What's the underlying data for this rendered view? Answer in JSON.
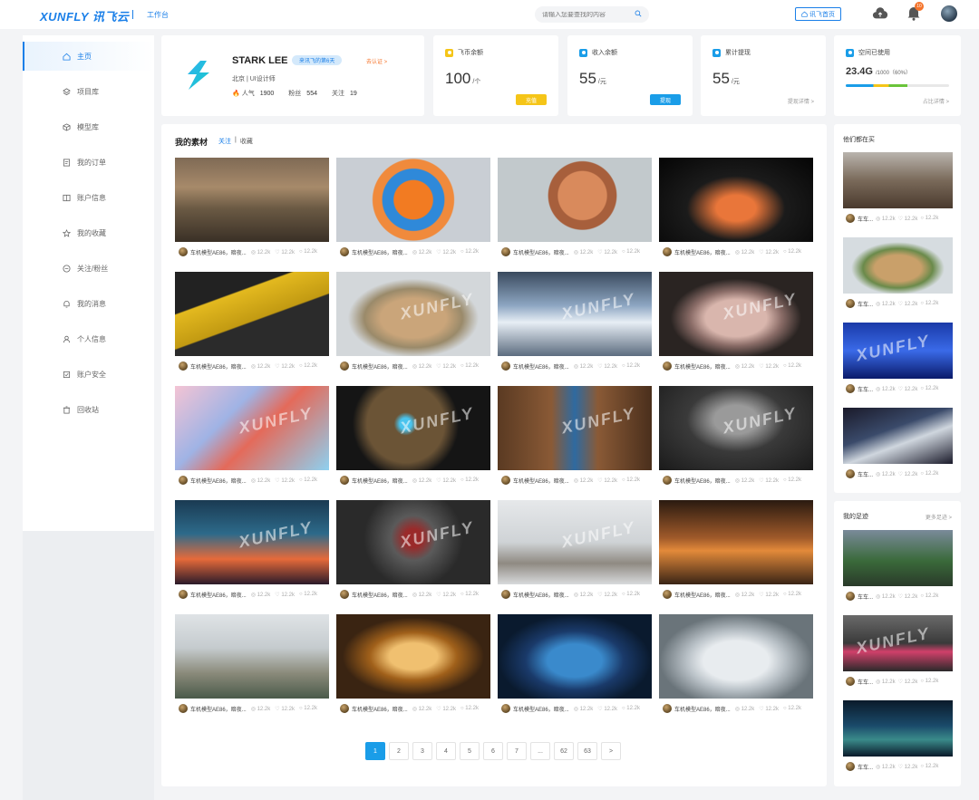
{
  "header": {
    "logo": "XUNFLY 讯飞云",
    "workbench": "工作台",
    "search_placeholder": "请输入您要查找的内容",
    "home_button": "讯飞首页",
    "notification_count": "10"
  },
  "sidebar": {
    "items": [
      {
        "label": "主页",
        "icon": "home-icon",
        "active": true
      },
      {
        "label": "项目库",
        "icon": "layers-icon"
      },
      {
        "label": "模型库",
        "icon": "cube-icon"
      },
      {
        "label": "我的订单",
        "icon": "order-icon"
      },
      {
        "label": "账户信息",
        "icon": "account-icon"
      },
      {
        "label": "我的收藏",
        "icon": "star-icon"
      },
      {
        "label": "关注/粉丝",
        "icon": "follow-icon"
      },
      {
        "label": "我的消息",
        "icon": "bell-icon"
      },
      {
        "label": "个人信息",
        "icon": "user-icon"
      },
      {
        "label": "账户安全",
        "icon": "shield-icon"
      },
      {
        "label": "回收站",
        "icon": "trash-icon"
      }
    ]
  },
  "profile": {
    "name": "STARK LEE",
    "tag": "来讯飞的第6天",
    "verify": "去认证 >",
    "location": "北京 | UI设计师",
    "popularity_label": "人气",
    "popularity": "1900",
    "fans_label": "粉丝",
    "fans": "554",
    "follow_label": "关注",
    "follow": "19"
  },
  "stats": [
    {
      "title": "飞币余额",
      "value": "100",
      "unit": "/个",
      "button": "充值",
      "color": "#f5c518"
    },
    {
      "title": "收入余额",
      "value": "55",
      "unit": "/元",
      "button": "提现",
      "color": "#1a9de8"
    },
    {
      "title": "累计提现",
      "value": "55",
      "unit": "/元",
      "link": "提现详情 >",
      "color": "#1a9de8"
    }
  ],
  "space": {
    "title": "空间已使用",
    "value": "23.4G",
    "detail": "/1000（60%）",
    "link": "占比详情 >",
    "fraction": 0.6,
    "color": "#1a9de8"
  },
  "materials": {
    "title": "我的素材",
    "tab_follow": "关注",
    "tab_sep": "|",
    "tab_collect": "收藏",
    "item_title": "车机模型AE86，暗夜...",
    "views": "12.2k",
    "likes": "12.2k",
    "comments": "12.2k"
  },
  "pagination": [
    "1",
    "2",
    "3",
    "4",
    "5",
    "6",
    "7",
    "...",
    "62",
    "63",
    ">"
  ],
  "selling": {
    "title": "他们都在买",
    "item_title": "车车...",
    "count": "12.2k"
  },
  "footprint": {
    "title": "我的足迹",
    "more": "更多足迹 >",
    "item_title": "车车...",
    "count": "12.2k"
  },
  "watermark": "XUNFLY"
}
